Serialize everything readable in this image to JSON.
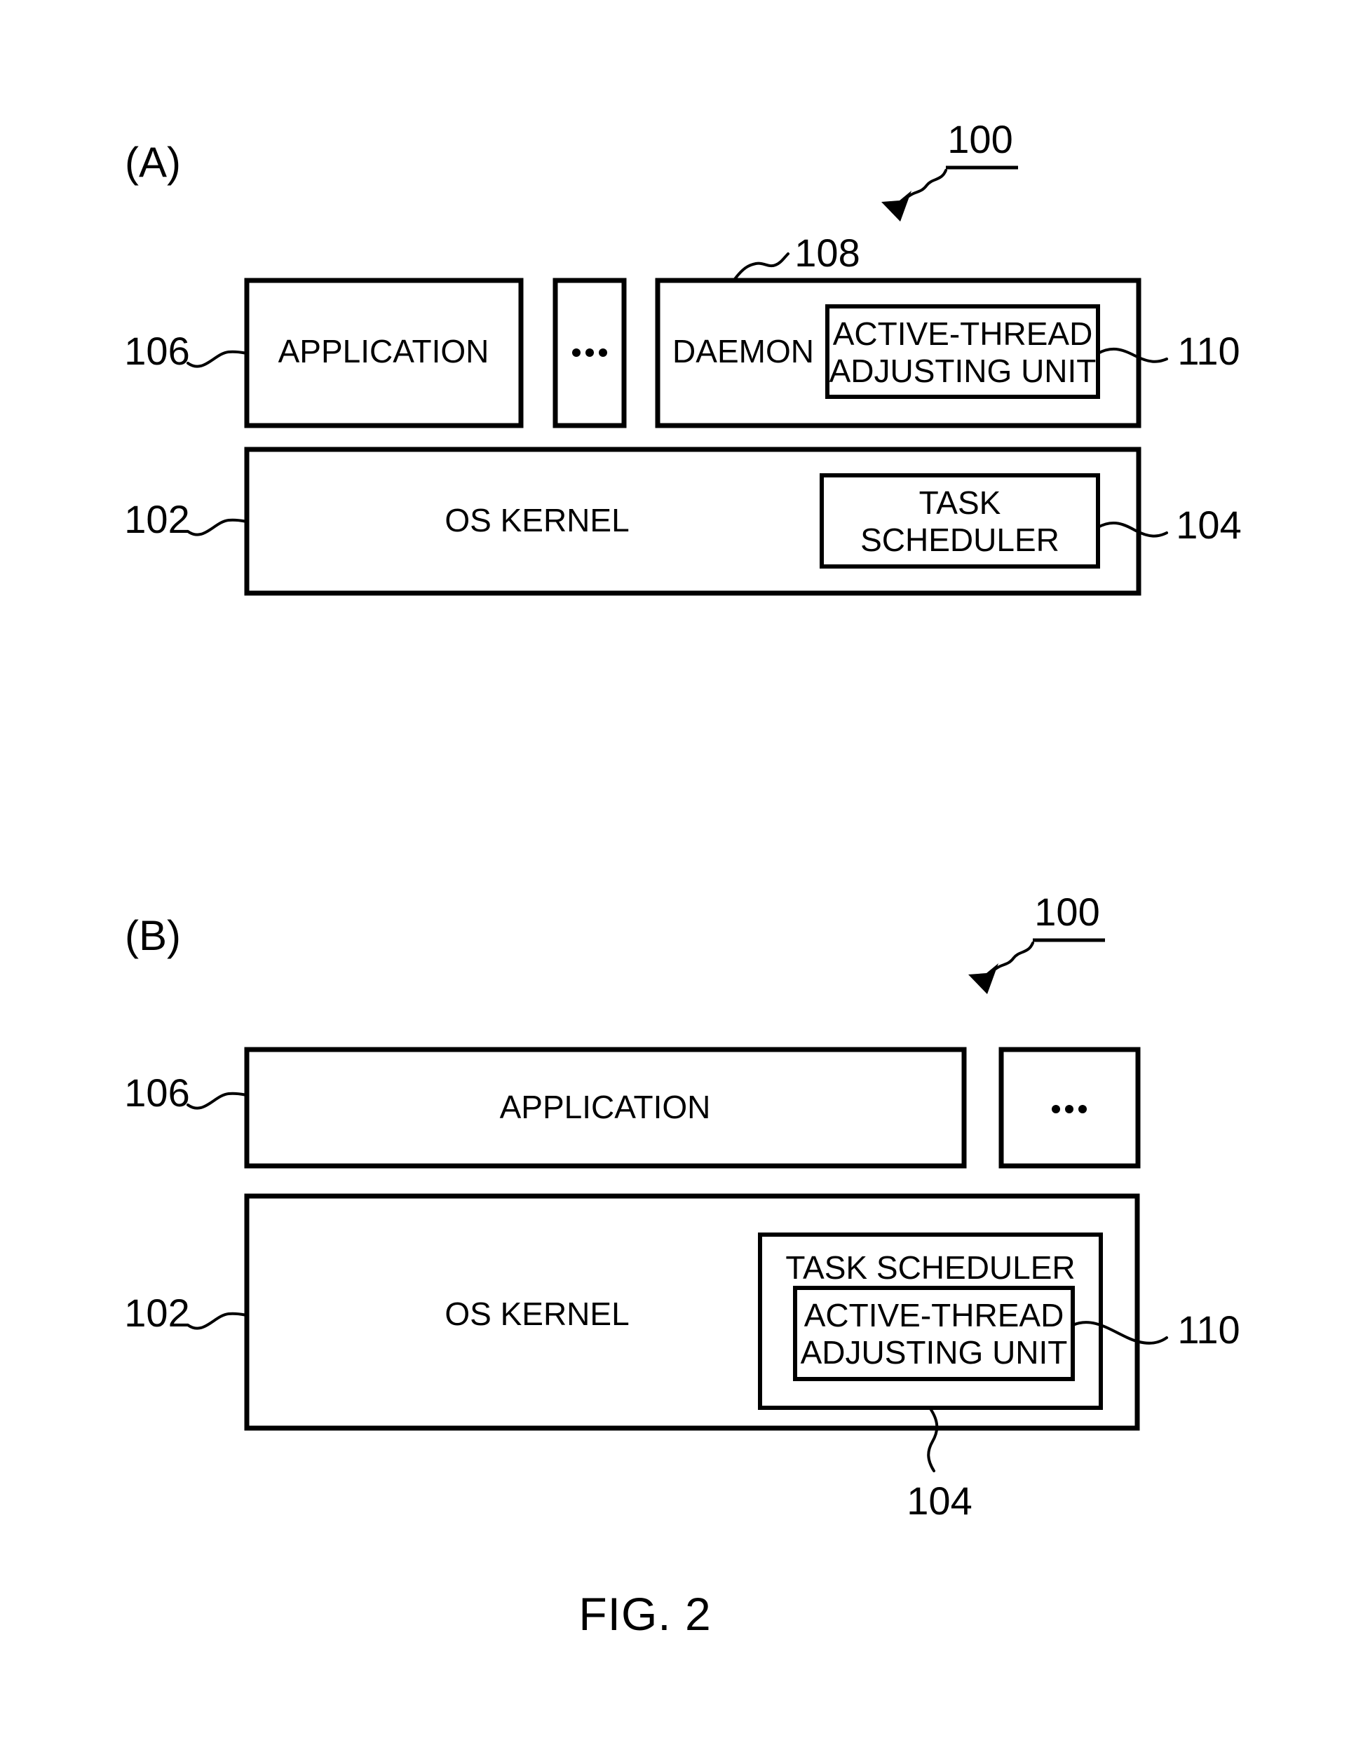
{
  "figure": {
    "caption": "FIG. 2",
    "panels": [
      {
        "id": "A",
        "label": "(A)",
        "system_ref": "100",
        "refs": {
          "application": "106",
          "os_kernel": "102",
          "daemon": "108",
          "task_scheduler": "104",
          "active_thread_adjusting_unit": "110"
        },
        "boxes": {
          "application": "APPLICATION",
          "ellipsis": "• • •",
          "daemon": "DAEMON",
          "active_thread_adjusting_unit_line1": "ACTIVE-THREAD",
          "active_thread_adjusting_unit_line2": "ADJUSTING UNIT",
          "os_kernel": "OS KERNEL",
          "task_scheduler_line1": "TASK",
          "task_scheduler_line2": "SCHEDULER"
        }
      },
      {
        "id": "B",
        "label": "(B)",
        "system_ref": "100",
        "refs": {
          "application": "106",
          "os_kernel": "102",
          "task_scheduler": "104",
          "active_thread_adjusting_unit": "110"
        },
        "boxes": {
          "application": "APPLICATION",
          "ellipsis": "• • •",
          "os_kernel": "OS KERNEL",
          "task_scheduler": "TASK SCHEDULER",
          "active_thread_adjusting_unit_line1": "ACTIVE-THREAD",
          "active_thread_adjusting_unit_line2": "ADJUSTING UNIT"
        }
      }
    ]
  },
  "colors": {
    "ink": "#000000",
    "paper": "#ffffff"
  }
}
